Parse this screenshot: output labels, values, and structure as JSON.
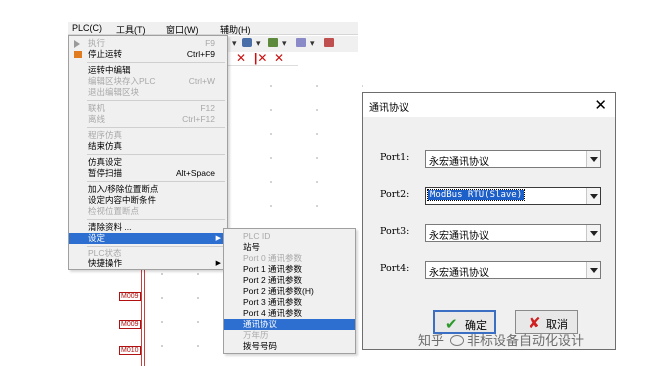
{
  "menubar": {
    "items": [
      "PLC(C)",
      "工具(T)",
      "窗口(W)",
      "辅助(H)"
    ]
  },
  "plc_menu": {
    "items": [
      {
        "label": "执行",
        "shortcut": "F9",
        "enabled": false
      },
      {
        "label": "停止运转",
        "shortcut": "Ctrl+F9",
        "enabled": true
      },
      {
        "label": "运转中编辑",
        "shortcut": "",
        "enabled": true
      },
      {
        "label": "编辑区块存入PLC",
        "shortcut": "Ctrl+W",
        "enabled": false
      },
      {
        "label": "退出编辑区块",
        "shortcut": "",
        "enabled": false
      },
      {
        "label": "联机",
        "shortcut": "F12",
        "enabled": false
      },
      {
        "label": "离线",
        "shortcut": "Ctrl+F12",
        "enabled": false
      },
      {
        "label": "程序仿真",
        "shortcut": "",
        "enabled": false
      },
      {
        "label": "结束仿真",
        "shortcut": "",
        "enabled": true
      },
      {
        "label": "仿真设定",
        "shortcut": "",
        "enabled": true
      },
      {
        "label": "暂停扫描",
        "shortcut": "Alt+Space",
        "enabled": true
      },
      {
        "label": "加入/移除位置断点",
        "shortcut": "",
        "enabled": true
      },
      {
        "label": "设定内容中断条件",
        "shortcut": "",
        "enabled": true
      },
      {
        "label": "检视位置断点",
        "shortcut": "",
        "enabled": false
      },
      {
        "label": "清除资料 ...",
        "shortcut": "",
        "enabled": true
      },
      {
        "label": "设定",
        "shortcut": "",
        "enabled": true
      },
      {
        "label": "PLC状态",
        "shortcut": "",
        "enabled": false
      },
      {
        "label": "快捷操作",
        "shortcut": "",
        "enabled": true
      }
    ]
  },
  "submenu": {
    "items": [
      {
        "label": "PLC ID",
        "enabled": false
      },
      {
        "label": "站号",
        "enabled": true
      },
      {
        "label": "Port 0 通讯参数",
        "enabled": false
      },
      {
        "label": "Port 1 通讯参数",
        "enabled": true
      },
      {
        "label": "Port 2 通讯参数",
        "enabled": true
      },
      {
        "label": "Port 2 通讯参数(H)",
        "enabled": true
      },
      {
        "label": "Port 3 通讯参数",
        "enabled": true
      },
      {
        "label": "Port 4 通讯参数",
        "enabled": true
      },
      {
        "label": "通讯协议",
        "enabled": true
      },
      {
        "label": "万年历",
        "enabled": false
      },
      {
        "label": "拨号号码",
        "enabled": true
      }
    ]
  },
  "toolbar": {
    "glyphs": [
      "▾",
      "▾",
      "▾",
      "▾"
    ]
  },
  "coils": [
    "M009",
    "M009",
    "M010"
  ],
  "dialog": {
    "title": "通讯协议",
    "close_glyph": "✕",
    "ports": [
      {
        "label": "Port1:",
        "value": "永宏通讯协议"
      },
      {
        "label": "Port2:",
        "value": "ModBus RTU(Slave)"
      },
      {
        "label": "Port3:",
        "value": "永宏通讯协议"
      },
      {
        "label": "Port4:",
        "value": "永宏通讯协议"
      }
    ],
    "ok_label": "确定",
    "cancel_label": "取消"
  },
  "watermark": {
    "text_left": "知乎",
    "text_right": "非标设备自动化设计"
  },
  "colors": {
    "highlight": "#2c6fd1",
    "menu_bg": "#f0f0f0",
    "ok_icon": "#2b9a2b",
    "cancel_icon": "#d02020"
  }
}
